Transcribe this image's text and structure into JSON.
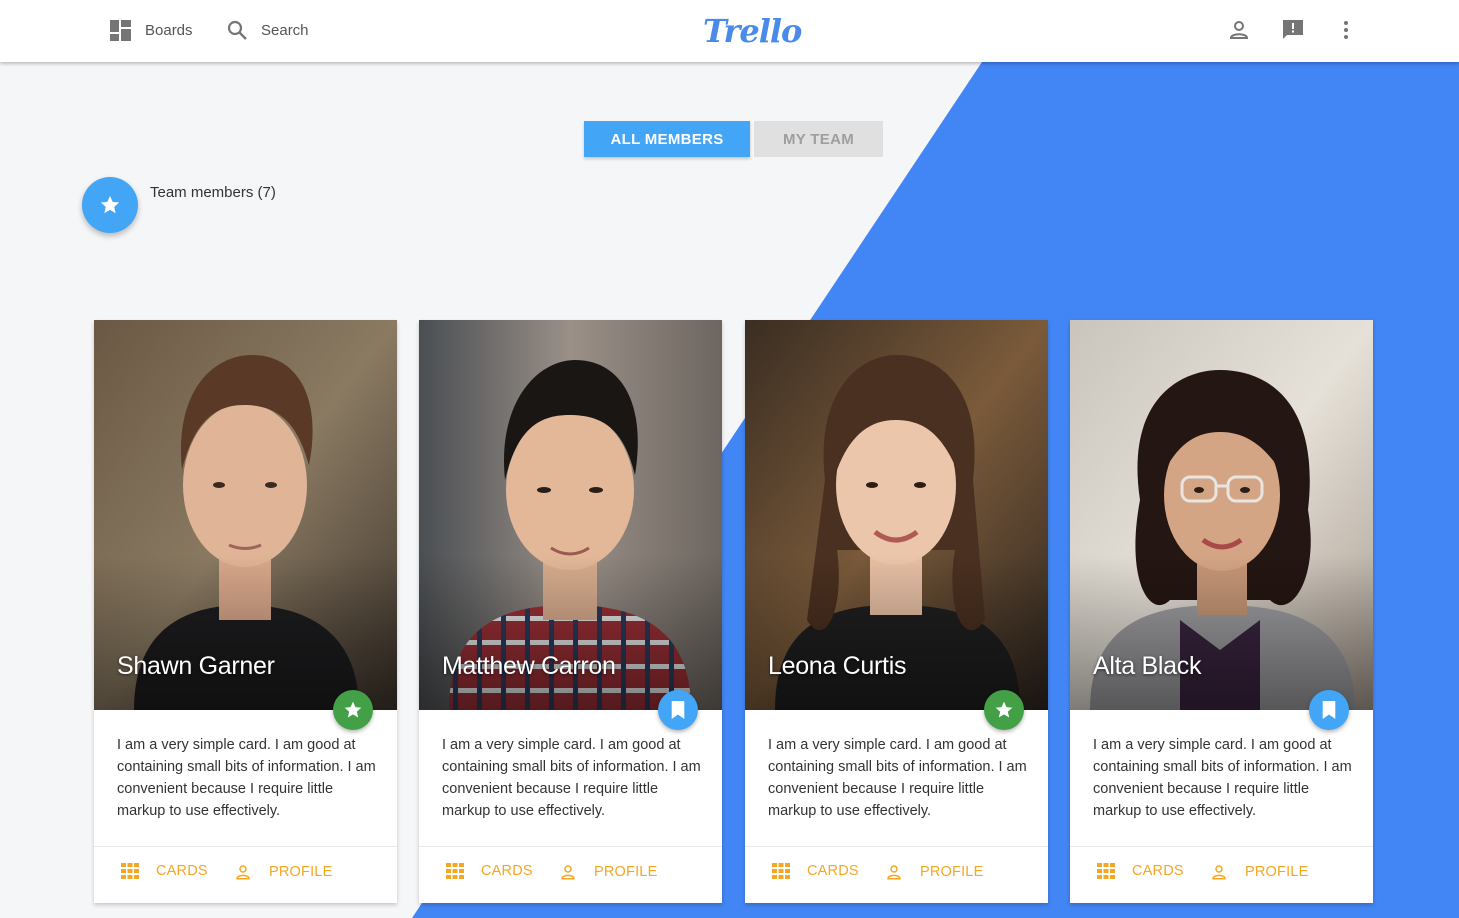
{
  "topbar": {
    "boards_label": "Boards",
    "search_label": "Search",
    "logo_text": "Trello"
  },
  "tabs": {
    "all_members": "ALL MEMBERS",
    "my_team": "MY TEAM"
  },
  "team": {
    "label": "Team members (7)"
  },
  "colors": {
    "primary_blue": "#42a5f5",
    "diagonal_blue": "#4285f4",
    "star_green": "#43a047",
    "action_orange": "#f5a623"
  },
  "cards": [
    {
      "name": "Shawn Garner",
      "badge": "star-icon",
      "description": "I am a very simple card. I am good at containing small bits of information. I am convenient because I require little markup to use effectively.",
      "cards_label": "CARDS",
      "profile_label": "PROFILE"
    },
    {
      "name": "Matthew Carron",
      "badge": "bookmark-icon",
      "description": "I am a very simple card. I am good at containing small bits of information. I am convenient because I require little markup to use effectively.",
      "cards_label": "CARDS",
      "profile_label": "PROFILE"
    },
    {
      "name": "Leona Curtis",
      "badge": "star-icon",
      "description": "I am a very simple card. I am good at containing small bits of information. I am convenient because I require little markup to use effectively.",
      "cards_label": "CARDS",
      "profile_label": "PROFILE"
    },
    {
      "name": "Alta Black",
      "badge": "bookmark-icon",
      "description": "I am a very simple card. I am good at containing small bits of information. I am convenient because I require little markup to use effectively.",
      "cards_label": "CARDS",
      "profile_label": "PROFILE"
    }
  ]
}
